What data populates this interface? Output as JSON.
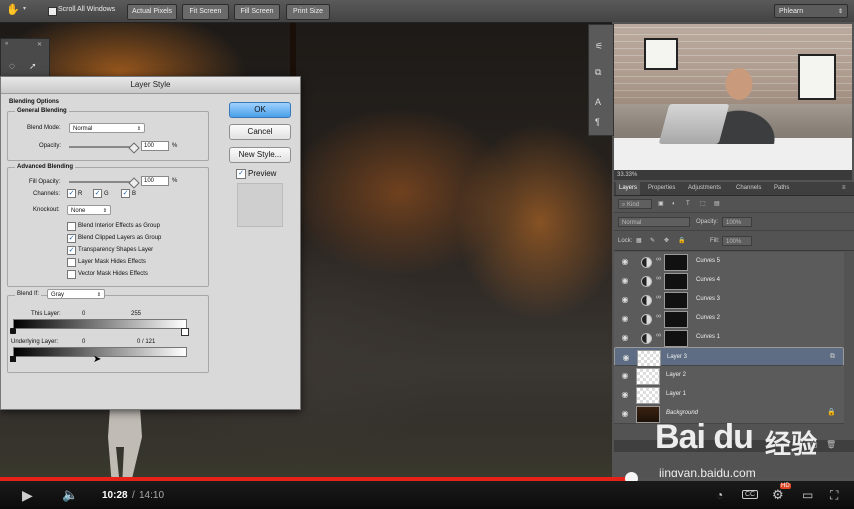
{
  "optionbar": {
    "scroll_all": "Scroll All Windows",
    "buttons": [
      "Actual Pixels",
      "Fit Screen",
      "Fill Screen",
      "Print Size"
    ],
    "workspace": "Phlearn"
  },
  "dialog": {
    "title": "Layer Style",
    "blending_options": "Blending Options",
    "general_blending": "General Blending",
    "blend_mode_label": "Blend Mode:",
    "blend_mode_value": "Normal",
    "opacity_label": "Opacity:",
    "opacity_value": "100",
    "pct": "%",
    "advanced_blending": "Advanced Blending",
    "fill_opacity_label": "Fill Opacity:",
    "fill_opacity_value": "100",
    "channels_label": "Channels:",
    "channel_r": "R",
    "channel_g": "G",
    "channel_b": "B",
    "knockout_label": "Knockout:",
    "knockout_value": "None",
    "checks": [
      {
        "label": "Blend Interior Effects as Group",
        "checked": false
      },
      {
        "label": "Blend Clipped Layers as Group",
        "checked": true
      },
      {
        "label": "Transparency Shapes Layer",
        "checked": true
      },
      {
        "label": "Layer Mask Hides Effects",
        "checked": false
      },
      {
        "label": "Vector Mask Hides Effects",
        "checked": false
      }
    ],
    "blend_if_label": "Blend If:",
    "blend_if_value": "Gray",
    "this_layer_label": "This Layer:",
    "this_layer_min": "0",
    "this_layer_max": "255",
    "underlying_label": "Underlying Layer:",
    "underlying_min": "0",
    "underlying_max": "0 / 121",
    "ok": "OK",
    "cancel": "Cancel",
    "new_style": "New Style...",
    "preview": "Preview"
  },
  "panel": {
    "zoom": "33.33%",
    "tabs": [
      "Layers",
      "Properties",
      "Adjustments",
      "Channels",
      "Paths"
    ],
    "kind_label": "Kind",
    "blend_mode": "Normal",
    "opacity_label": "Opacity:",
    "opacity_value": "100%",
    "lock_label": "Lock:",
    "fill_label": "Fill:",
    "fill_value": "100%",
    "layers": [
      {
        "name": "Curves 5",
        "type": "adjustment"
      },
      {
        "name": "Curves 4",
        "type": "adjustment"
      },
      {
        "name": "Curves 3",
        "type": "adjustment"
      },
      {
        "name": "Curves 2",
        "type": "adjustment"
      },
      {
        "name": "Curves 1",
        "type": "adjustment"
      },
      {
        "name": "Layer 3",
        "type": "pixel",
        "selected": true
      },
      {
        "name": "Layer 2",
        "type": "pixel"
      },
      {
        "name": "Layer 1",
        "type": "pixel"
      },
      {
        "name": "Background",
        "type": "background"
      }
    ]
  },
  "player": {
    "current_time": "10:28",
    "separator": "/",
    "duration": "14:10",
    "progress": 0.739,
    "hd_badge": "HD",
    "cc_label": "CC"
  },
  "watermark": {
    "logo": "Bai du",
    "cn": "经验",
    "url": "jingyan.baidu.com"
  }
}
